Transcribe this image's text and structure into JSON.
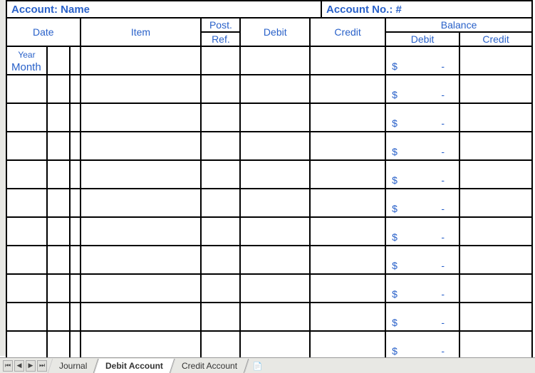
{
  "header": {
    "account_name_label": "Account: Name",
    "account_no_label": "Account No.: #"
  },
  "columns": {
    "date": "Date",
    "item": "Item",
    "post_ref_top": "Post.",
    "post_ref_bottom": "Ref.",
    "debit": "Debit",
    "credit": "Credit",
    "balance": "Balance",
    "bal_debit": "Debit",
    "bal_credit": "Credit"
  },
  "subheaders": {
    "year": "Year",
    "month": "Month"
  },
  "rows": [
    {
      "bal_debit_sym": "$",
      "bal_debit_val": "-"
    },
    {
      "bal_debit_sym": "$",
      "bal_debit_val": "-"
    },
    {
      "bal_debit_sym": "$",
      "bal_debit_val": "-"
    },
    {
      "bal_debit_sym": "$",
      "bal_debit_val": "-"
    },
    {
      "bal_debit_sym": "$",
      "bal_debit_val": "-"
    },
    {
      "bal_debit_sym": "$",
      "bal_debit_val": "-"
    },
    {
      "bal_debit_sym": "$",
      "bal_debit_val": "-"
    },
    {
      "bal_debit_sym": "$",
      "bal_debit_val": "-"
    },
    {
      "bal_debit_sym": "$",
      "bal_debit_val": "-"
    },
    {
      "bal_debit_sym": "$",
      "bal_debit_val": "-"
    },
    {
      "bal_debit_sym": "$",
      "bal_debit_val": "-"
    }
  ],
  "tabs": {
    "journal": "Journal",
    "debit_account": "Debit Account",
    "credit_account": "Credit Account"
  }
}
